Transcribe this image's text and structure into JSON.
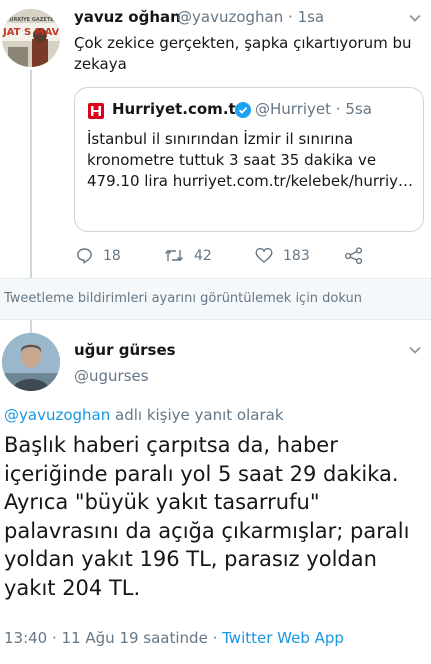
{
  "tweet1": {
    "author_name": "yavuz oğhan",
    "author_handle": "@yavuzoghan",
    "time_sep": "·",
    "time": "1sa",
    "avatar_text_top": "TÜRKİYE GAZETESİ",
    "avatar_text_big": "JAT S MAVİ",
    "text": "Çok zekice gerçekten, şapka çıkartıyorum bu zekaya",
    "quote": {
      "source_name": "Hurriyet.com.tr",
      "source_handle": "@Hurriyet",
      "time_sep": "·",
      "time": "5sa",
      "text": "İstanbul il sınırından İzmir il sınırına kronometre tuttuk 3 saat 35 dakika ve 479.10 lira hurriyet.com.tr/kelebek/hurriy…"
    },
    "actions": {
      "reply_count": "18",
      "retweet_count": "42",
      "like_count": "183"
    }
  },
  "notification_text": "Tweetleme bildirimleri ayarını görüntülemek için dokun",
  "tweet2": {
    "author_name": "uğur gürses",
    "author_handle": "@ugurses",
    "reply_to_handle": "@yavuzoghan",
    "reply_to_suffix": " adlı kişiye yanıt olarak",
    "text": "Başlık haberi çarpıtsa da, haber içeriğinde paralı yol 5 saat 29 dakika. Ayrıca \"büyük yakıt tasarrufu\" palavrasını da açığa çıkarmışlar; paralı yoldan yakıt 196 TL, parasız yoldan yakıt 204 TL.",
    "timestamp": "13:40 · 11 Ağu 19 saatinde ·",
    "client": "Twitter Web App"
  },
  "icons": {
    "reply": "comment-icon",
    "retweet": "retweet-icon",
    "like": "heart-icon",
    "share": "share-icon",
    "verified": "verified-badge-icon",
    "chevron": "chevron-down-icon"
  },
  "colors": {
    "link": "#1b95e0",
    "muted": "#657786",
    "border": "#ccd6dd",
    "brand_red": "#e0001b"
  }
}
